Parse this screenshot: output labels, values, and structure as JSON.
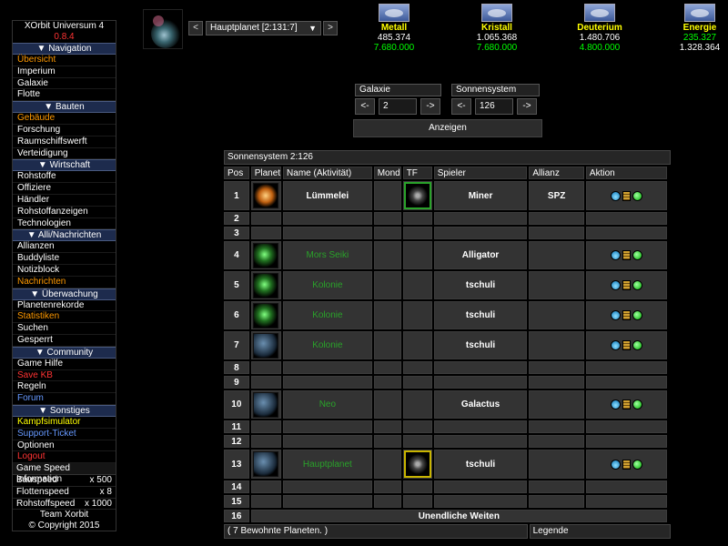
{
  "menu": {
    "title": "XOrbit Universum 4",
    "version": "0.8.4",
    "sections": [
      {
        "label": "Navigation",
        "items": [
          {
            "label": "Übersicht",
            "color": "orange"
          },
          {
            "label": "Imperium",
            "color": "white"
          },
          {
            "label": "Galaxie",
            "color": "white"
          },
          {
            "label": "Flotte",
            "color": "white"
          }
        ]
      },
      {
        "label": "Bauten",
        "items": [
          {
            "label": "Gebäude",
            "color": "orange"
          },
          {
            "label": "Forschung",
            "color": "white"
          },
          {
            "label": "Raumschiffswerft",
            "color": "white"
          },
          {
            "label": "Verteidigung",
            "color": "white"
          }
        ]
      },
      {
        "label": "Wirtschaft",
        "items": [
          {
            "label": "Rohstoffe",
            "color": "white"
          },
          {
            "label": "Offiziere",
            "color": "white"
          },
          {
            "label": "Händler",
            "color": "white"
          },
          {
            "label": "Rohstoffanzeigen",
            "color": "white"
          },
          {
            "label": "Technologien",
            "color": "white"
          }
        ]
      },
      {
        "label": "Alli/Nachrichten",
        "items": [
          {
            "label": "Allianzen",
            "color": "white"
          },
          {
            "label": "Buddyliste",
            "color": "white"
          },
          {
            "label": "Notizblock",
            "color": "white"
          },
          {
            "label": "Nachrichten",
            "color": "orange"
          }
        ]
      },
      {
        "label": "Überwachung",
        "items": [
          {
            "label": "Planetenrekorde",
            "color": "white"
          },
          {
            "label": "Statistiken",
            "color": "orange"
          },
          {
            "label": "Suchen",
            "color": "white"
          },
          {
            "label": "Gesperrt",
            "color": "white"
          }
        ]
      },
      {
        "label": "Community",
        "items": [
          {
            "label": "Game Hilfe",
            "color": "white"
          },
          {
            "label": "Save KB",
            "color": "red"
          },
          {
            "label": "Regeln",
            "color": "white"
          },
          {
            "label": "Forum",
            "color": "blue"
          }
        ]
      },
      {
        "label": "Sonstiges",
        "items": [
          {
            "label": "Kampfsimulator",
            "color": "yellow"
          },
          {
            "label": "Support-Ticket",
            "color": "blue"
          },
          {
            "label": "Optionen",
            "color": "white"
          },
          {
            "label": "Logout",
            "color": "red"
          }
        ]
      }
    ],
    "game_speed": {
      "title": "Game Speed Information",
      "rows": [
        {
          "label": "Bauspeed",
          "value": "x 500"
        },
        {
          "label": "Flottenspeed",
          "value": "x 8"
        },
        {
          "label": "Rohstoffspeed",
          "value": "x 1000"
        }
      ]
    },
    "team": "Team Xorbit",
    "copyright": "© Copyright 2015"
  },
  "topbar": {
    "prev": "<",
    "next": ">",
    "planet_selected": "Hauptplanet [2:131:7]",
    "resources": [
      {
        "name": "Metall",
        "amount": "485.374",
        "capacity": "7.680.000"
      },
      {
        "name": "Kristall",
        "amount": "1.065.368",
        "capacity": "7.680.000"
      },
      {
        "name": "Deuterium",
        "amount": "1.480.706",
        "capacity": "4.800.000"
      },
      {
        "name": "Energie",
        "amount": "235.327",
        "capacity": "1.328.364"
      }
    ]
  },
  "nav": {
    "galaxy_label": "Galaxie",
    "galaxy_value": "2",
    "system_label": "Sonnensystem",
    "system_value": "126",
    "prev": "<-",
    "next": "->",
    "show": "Anzeigen"
  },
  "galaxy": {
    "title": "Sonnensystem 2:126",
    "headers": [
      "Pos",
      "Planet",
      "Name (Aktivität)",
      "Mond",
      "TF",
      "Spieler",
      "Allianz",
      "Aktion"
    ],
    "rows": [
      {
        "pos": "1",
        "planet": true,
        "img": "fire",
        "name": "Lümmelei",
        "strong": true,
        "tf": "green",
        "player": "Miner",
        "ally": "SPZ",
        "actions": true
      },
      {
        "pos": "2"
      },
      {
        "pos": "3"
      },
      {
        "pos": "4",
        "planet": true,
        "img": "green",
        "name": "Mors Seiki",
        "player": "Alligator",
        "actions": true
      },
      {
        "pos": "5",
        "planet": true,
        "img": "green",
        "name": "Kolonie",
        "player": "tschuli",
        "actions": true
      },
      {
        "pos": "6",
        "planet": true,
        "img": "green",
        "name": "Kolonie",
        "player": "tschuli",
        "actions": true
      },
      {
        "pos": "7",
        "planet": true,
        "img": "blue",
        "name": "Kolonie",
        "player": "tschuli",
        "actions": true
      },
      {
        "pos": "8"
      },
      {
        "pos": "9"
      },
      {
        "pos": "10",
        "planet": true,
        "img": "blue",
        "name": "Neo",
        "player": "Galactus",
        "actions": true
      },
      {
        "pos": "11"
      },
      {
        "pos": "12"
      },
      {
        "pos": "13",
        "planet": true,
        "img": "blue",
        "name": "Hauptplanet",
        "tf": "yellow",
        "player": "tschuli",
        "actions": true
      },
      {
        "pos": "14"
      },
      {
        "pos": "15"
      }
    ],
    "last_pos": "16",
    "last_text": "Unendliche Weiten",
    "footer_left": "( 7 Bewohnte Planeten. )",
    "footer_right": "Legende"
  }
}
